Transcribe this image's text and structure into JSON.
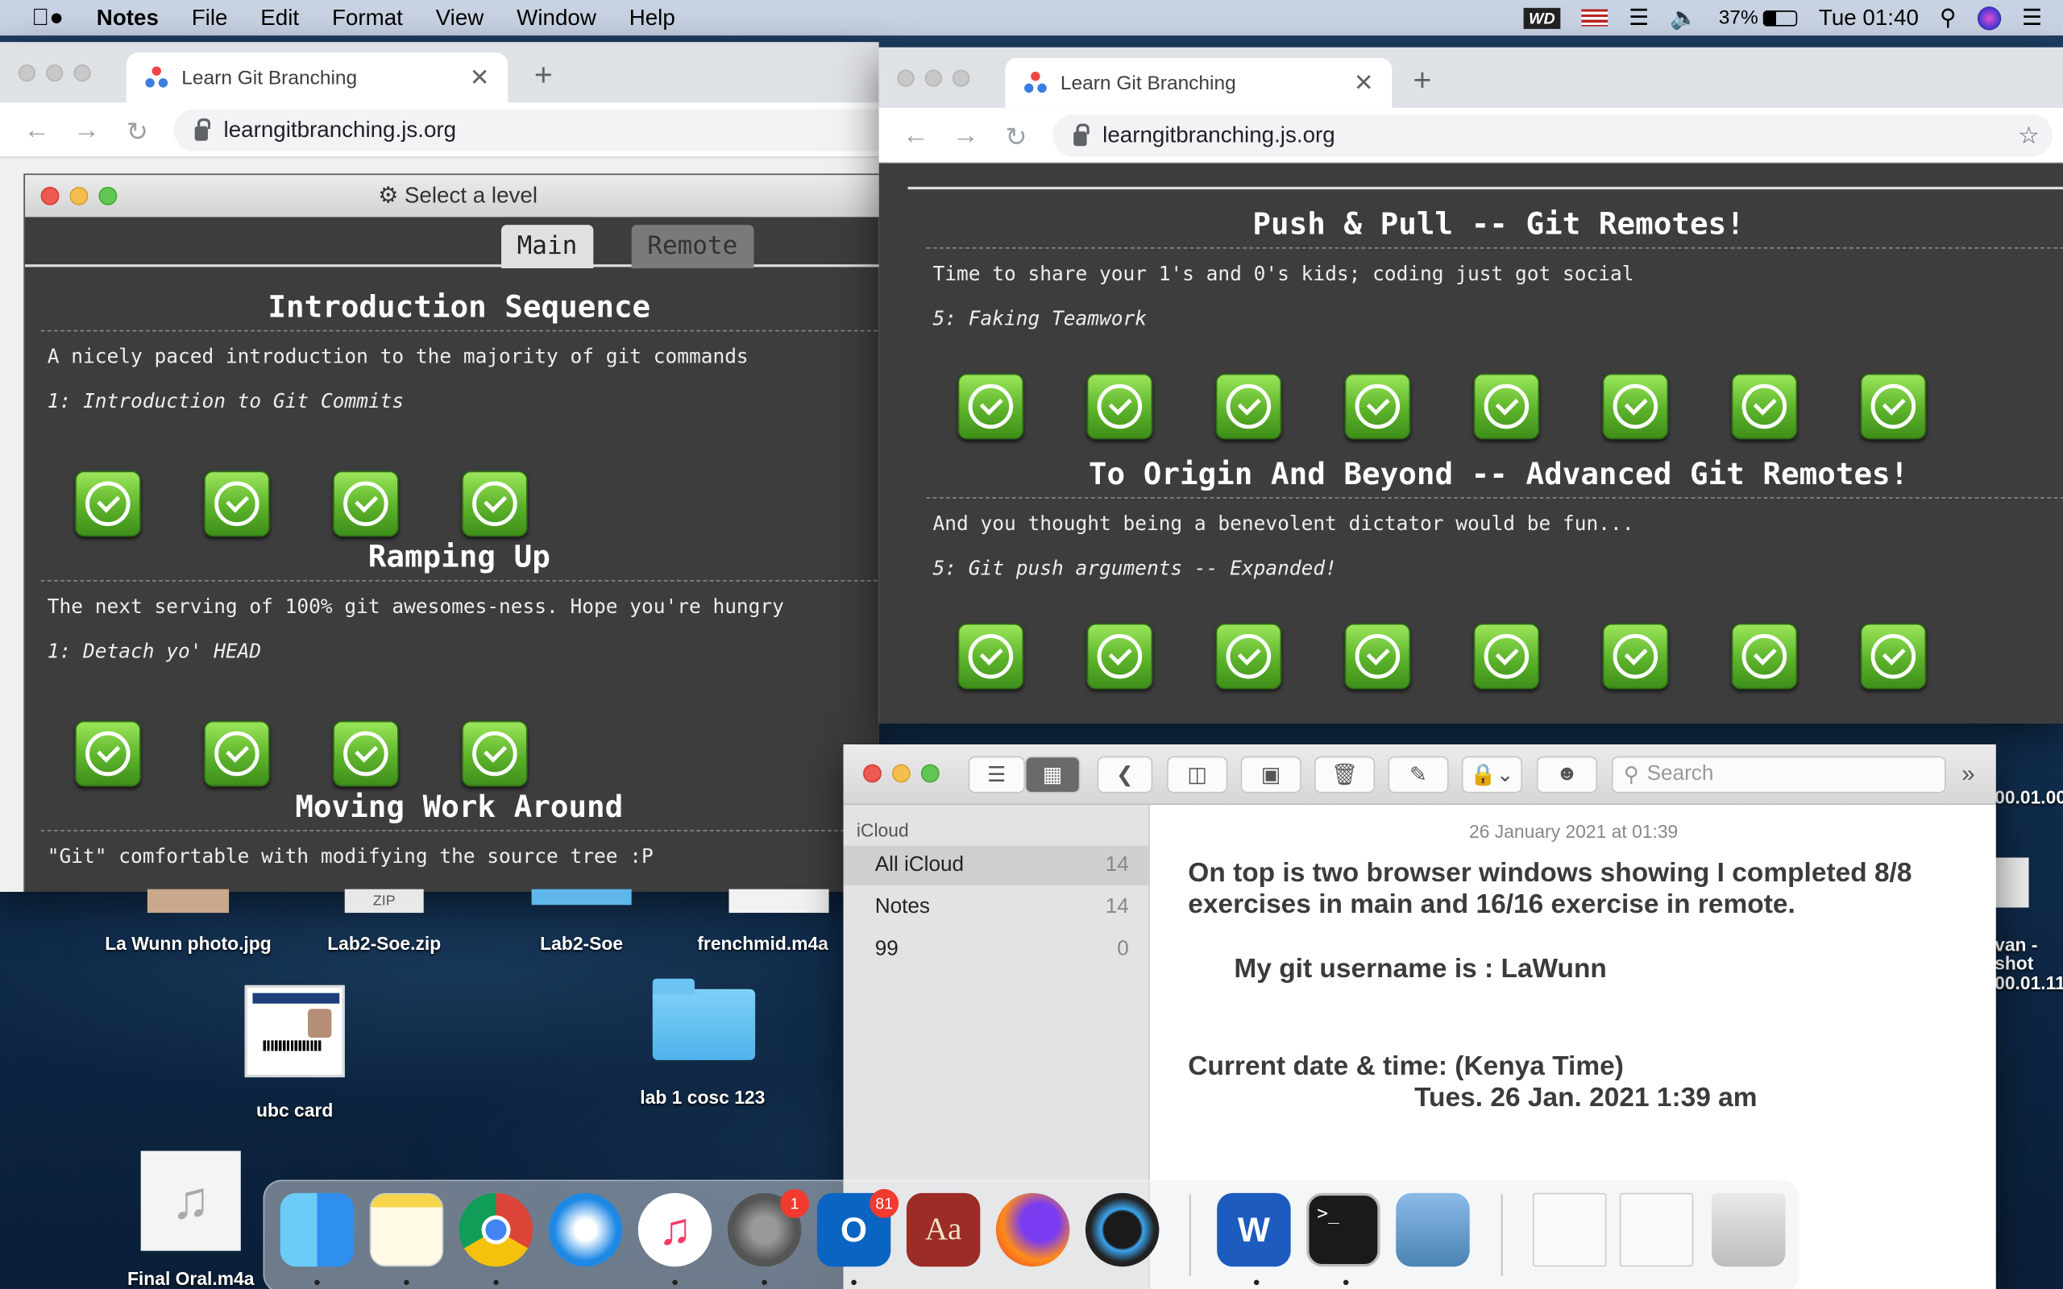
{
  "menubar": {
    "app": "Notes",
    "items": [
      "File",
      "Edit",
      "Format",
      "View",
      "Window",
      "Help"
    ],
    "battery": "37%",
    "time": "Tue 01:40",
    "wd": "WD"
  },
  "browser_left": {
    "tab_title": "Learn Git Branching",
    "url": "learngitbranching.js.org"
  },
  "browser_right": {
    "tab_title": "Learn Git Branching",
    "url": "learngitbranching.js.org"
  },
  "level_dialog": {
    "title": "Select a level",
    "tabs": [
      "Main",
      "Remote"
    ],
    "sections": [
      {
        "heading": "Introduction Sequence",
        "description": "A nicely paced introduction to the majority of git commands",
        "level": "1: Introduction to Git Commits",
        "completed": 4
      },
      {
        "heading": "Ramping Up",
        "description": "The next serving of 100% git awesomes-ness. Hope you're hungry",
        "level": "1: Detach yo' HEAD",
        "completed": 4
      },
      {
        "heading": "Moving Work Around",
        "description": "\"Git\" comfortable with modifying the source tree :P"
      }
    ]
  },
  "remote_page": {
    "sections": [
      {
        "heading": "Push & Pull -- Git Remotes!",
        "description": "Time to share your 1's and 0's kids; coding just got social",
        "level": "5: Faking Teamwork",
        "completed": 8
      },
      {
        "heading": "To Origin And Beyond -- Advanced Git Remotes!",
        "description": "And you thought being a benevolent dictator would be fun...",
        "level": "5: Git push arguments -- Expanded!",
        "completed": 8
      }
    ]
  },
  "notes": {
    "search_placeholder": "Search",
    "account": "iCloud",
    "folders": [
      {
        "name": "All iCloud",
        "count": "14"
      },
      {
        "name": "Notes",
        "count": "14"
      },
      {
        "name": "99",
        "count": "0"
      }
    ],
    "date": "26 January 2021 at 01:39",
    "line1": "On top is two browser windows showing I completed 8/8",
    "line2": "exercises in main and 16/16 exercise in remote.",
    "line3": "My git username is : LaWunn",
    "line4": "Current date & time: (Kenya Time)",
    "line5": "Tues. 26 Jan. 2021 1:39 am"
  },
  "desktop": {
    "icons": [
      "La Wunn photo.jpg",
      "Lab2-Soe.zip",
      "Lab2-Soe",
      "frenchmid.m4a",
      "ubc card",
      "lab 1 cosc 123",
      "Final Oral.m4a"
    ],
    "partial": [
      "van -",
      "shot",
      "00.01.11",
      "00.01.00"
    ],
    "zip_text": "ZIP"
  },
  "dock": {
    "apps": [
      "Finder",
      "Notes",
      "Chrome",
      "Safari",
      "Music",
      "System Preferences",
      "Outlook",
      "Dictionary",
      "Firefox",
      "QuickTime",
      "Word",
      "Terminal",
      "Preview",
      "Documents",
      "Word Document",
      "Trash"
    ],
    "badges": {
      "system_preferences": "1",
      "outlook": "81"
    }
  }
}
